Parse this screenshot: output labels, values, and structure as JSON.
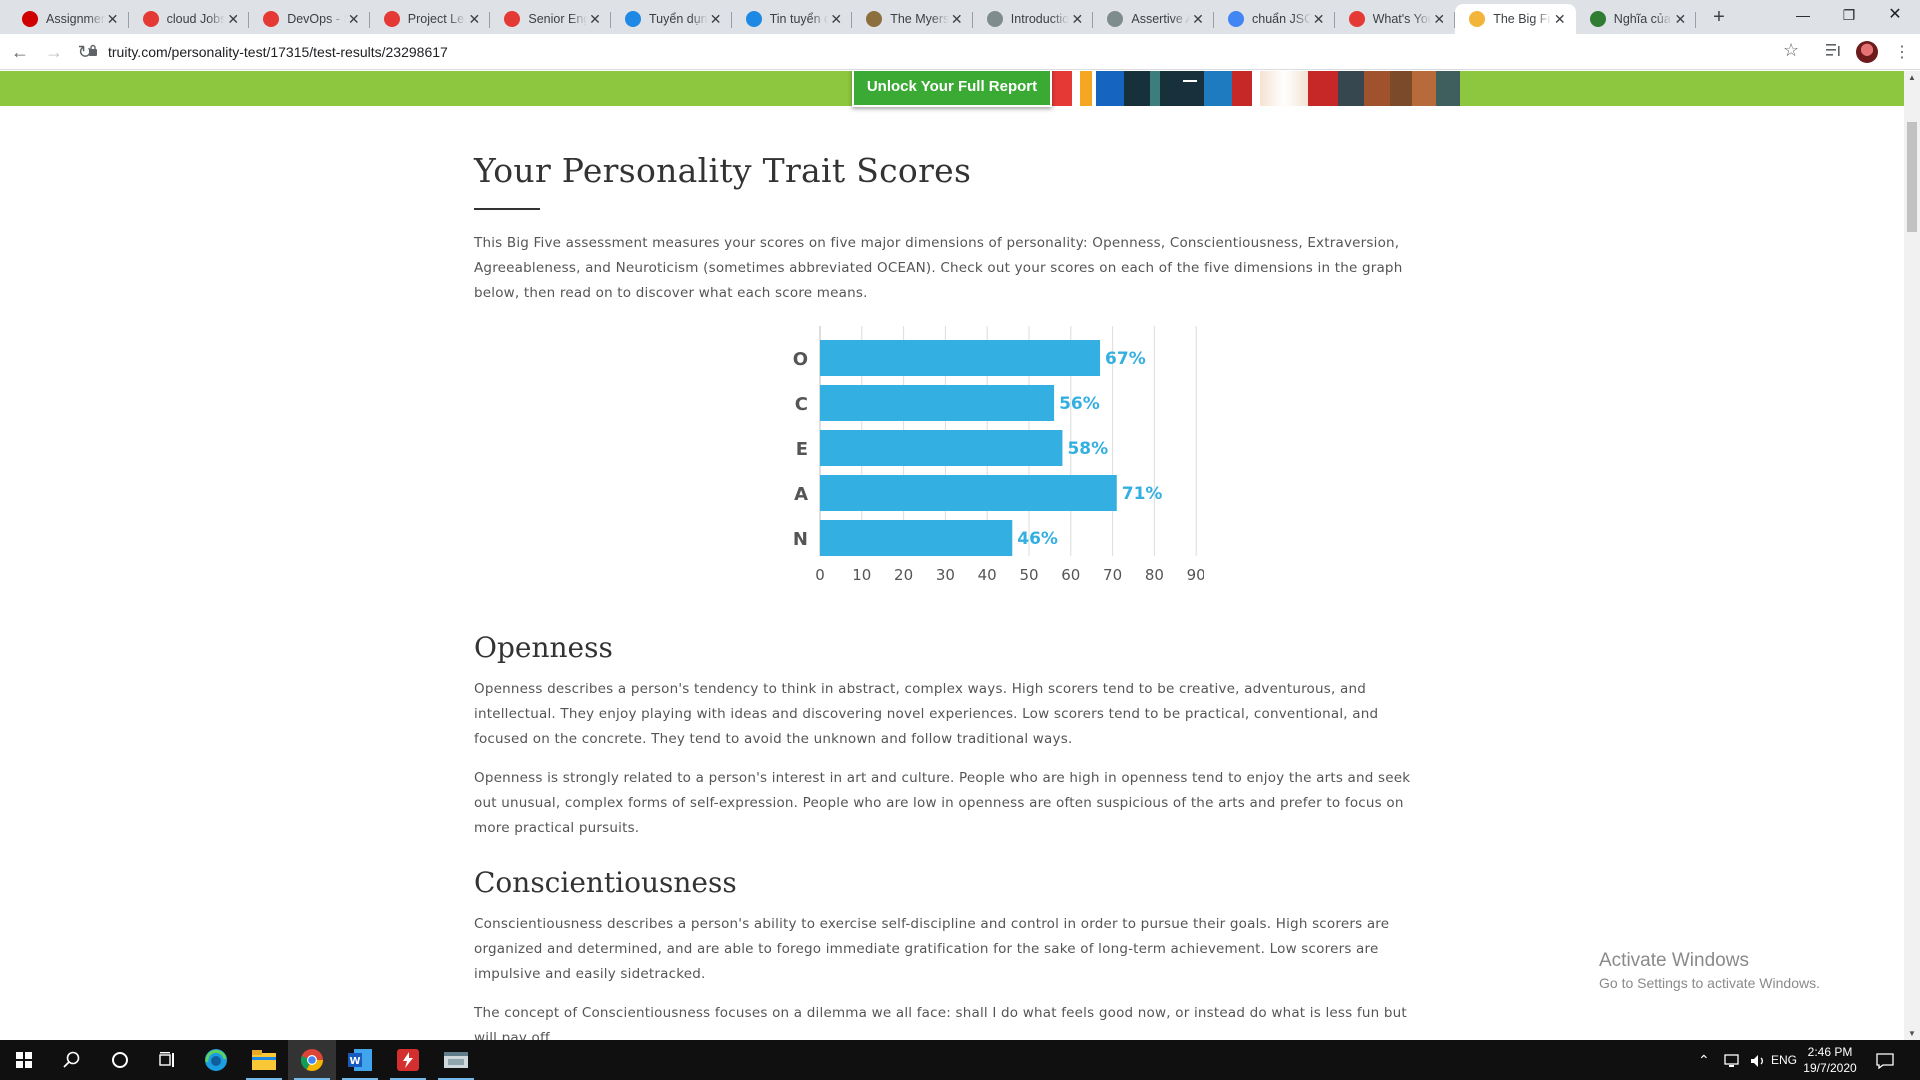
{
  "browser": {
    "tabs": [
      {
        "title": "Assignmen",
        "icon": "red-circle-icon",
        "color": "#d00000"
      },
      {
        "title": "cloud Jobs",
        "icon": "topdev-icon",
        "color": "#e53935"
      },
      {
        "title": "DevOps - S",
        "icon": "topdev-icon",
        "color": "#e53935"
      },
      {
        "title": "Project Lea",
        "icon": "topdev-icon",
        "color": "#e53935"
      },
      {
        "title": "Senior Eng",
        "icon": "topdev-icon",
        "color": "#e53935"
      },
      {
        "title": "Tuyển dụn",
        "icon": "flag-icon",
        "color": "#1e88e5"
      },
      {
        "title": "Tin tuyển d",
        "icon": "flag-icon",
        "color": "#1e88e5"
      },
      {
        "title": "The Myers",
        "icon": "mb-icon",
        "color": "#8d6e3f"
      },
      {
        "title": "Introductio",
        "icon": "globe-icon",
        "color": "#7f8c8d"
      },
      {
        "title": "Assertive A",
        "icon": "globe-icon",
        "color": "#7f8c8d"
      },
      {
        "title": "chuẩn JSO",
        "icon": "google-icon",
        "color": "#4285f4"
      },
      {
        "title": "What's You",
        "icon": "opera-icon",
        "color": "#e53935"
      },
      {
        "title": "The Big Fi",
        "icon": "bulb-icon",
        "color": "#f2b53a",
        "active": true
      },
      {
        "title": "Nghĩa của",
        "icon": "leaf-icon",
        "color": "#2e7d32"
      }
    ],
    "url": "truity.com/personality-test/17315/test-results/23298617"
  },
  "page": {
    "cta": "Unlock Your Full Report",
    "title": "Your Personality Trait Scores",
    "intro": "This Big Five assessment measures your scores on five major dimensions of personality: Openness, Conscientiousness, Extraversion, Agreeableness, and Neuroticism (sometimes abbreviated OCEAN). Check out your scores on each of the five dimensions in the graph below, then read on to discover what each score means.",
    "openness": {
      "heading": "Openness",
      "p1": "Openness describes a person's tendency to think in abstract, complex ways. High scorers tend to be creative, adventurous, and intellectual. They enjoy playing with ideas and discovering novel experiences. Low scorers tend to be practical, conventional, and focused on the concrete. They tend to avoid the unknown and follow traditional ways.",
      "p2": "Openness is strongly related to a person's interest in art and culture. People who are high in openness tend to enjoy the arts and seek out unusual, complex forms of self-expression. People who are low in openness are often suspicious of the arts and prefer to focus on more practical pursuits."
    },
    "conscientiousness": {
      "heading": "Conscientiousness",
      "p1": "Conscientiousness describes a person's ability to exercise self-discipline and control in order to pursue their goals. High scorers are organized and determined, and are able to forego immediate gratification for the sake of long-term achievement. Low scorers are impulsive and easily sidetracked.",
      "p2": "The concept of Conscientiousness focuses on a dilemma we all face: shall I do what feels good now, or instead do what is less fun but will pay off"
    }
  },
  "chart_data": {
    "type": "bar",
    "orientation": "horizontal",
    "categories": [
      "O",
      "C",
      "E",
      "A",
      "N"
    ],
    "values": [
      67,
      56,
      58,
      71,
      46
    ],
    "value_labels": [
      "67%",
      "56%",
      "58%",
      "71%",
      "46%"
    ],
    "xlim": [
      0,
      100
    ],
    "xticks": [
      0,
      10,
      20,
      30,
      40,
      50,
      60,
      70,
      80,
      90,
      100
    ],
    "bar_color": "#33b0e1",
    "grid": true
  },
  "watermark": {
    "line1": "Activate Windows",
    "line2": "Go to Settings to activate Windows."
  },
  "taskbar": {
    "lang": "ENG",
    "time": "2:46 PM",
    "date": "19/7/2020"
  },
  "colors": {
    "green_band": "#8dc63f",
    "cta_green": "#3aaa35",
    "bar": "#33b0e1"
  }
}
